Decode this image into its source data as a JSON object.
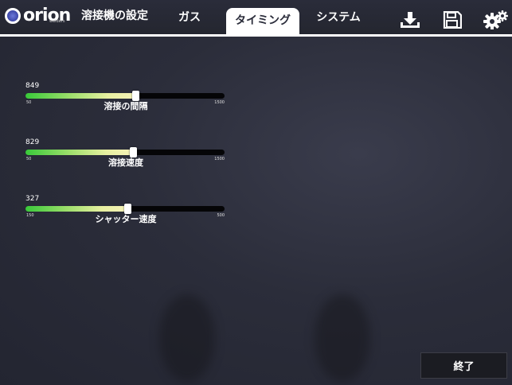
{
  "brand": {
    "name": "orion",
    "sub": "welders"
  },
  "tabs": [
    {
      "label": "溶接機の設定"
    },
    {
      "label": "ガス"
    },
    {
      "label": "タイミング"
    },
    {
      "label": "システム"
    }
  ],
  "active_tab": "タイミング",
  "toolbar": {
    "download_icon": "download-icon",
    "save_icon": "save-icon",
    "settings_icon": "gears-icon"
  },
  "sliders": [
    {
      "label": "溶接の間隔",
      "value": "849",
      "min": "50",
      "max": "1500",
      "fraction": 0.55
    },
    {
      "label": "溶接速度",
      "value": "829",
      "min": "50",
      "max": "1500",
      "fraction": 0.54
    },
    {
      "label": "シャッター速度",
      "value": "327",
      "min": "150",
      "max": "500",
      "fraction": 0.51
    }
  ],
  "footer": {
    "exit_label": "終了"
  },
  "colors": {
    "accent": "#ffffff",
    "fill_start": "#39c93a",
    "fill_end": "#f6f2b8"
  }
}
